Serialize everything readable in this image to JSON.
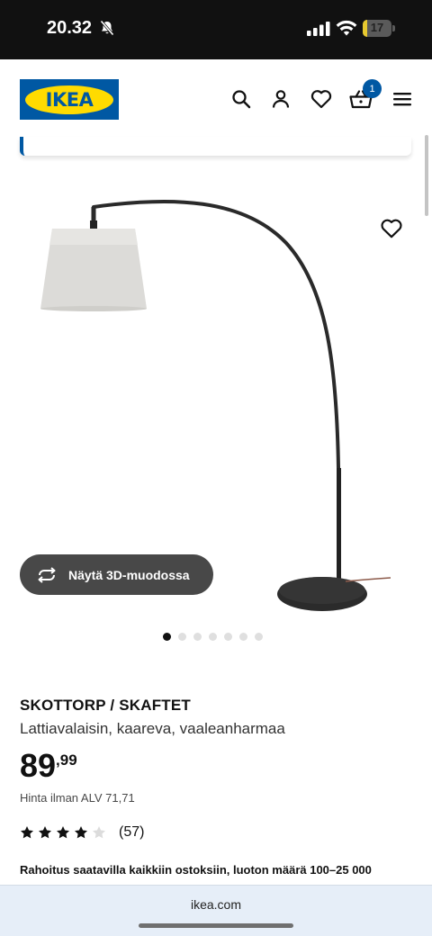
{
  "status_bar": {
    "time": "20.32",
    "battery_level": "17",
    "battery_fraction": 0.17
  },
  "header": {
    "logo_text": "IKEA",
    "cart_count": "1",
    "icons": [
      "search-icon",
      "account-icon",
      "heart-icon",
      "basket-icon",
      "menu-icon"
    ]
  },
  "product": {
    "name": "SKOTTORP / SKAFTET",
    "description": "Lattiavalaisin, kaareva, vaaleanharmaa",
    "price_integer": "89",
    "price_decimal": ",99",
    "price_without_vat": "Hinta ilman ALV 71,71",
    "rating_value": 4,
    "rating_max": 5,
    "rating_count": "(57)",
    "financing_text": "Rahoitus saatavilla kaikkiin ostoksiin, luoton määrä 100–25 000"
  },
  "image": {
    "view_3d_label": "Näytä 3D-muodossa",
    "carousel_total": 7,
    "carousel_active": 1
  },
  "browser": {
    "url": "ikea.com"
  },
  "colors": {
    "ikea_blue": "#0058a3",
    "ikea_yellow": "#ffdb00",
    "button_dark": "#484848"
  }
}
